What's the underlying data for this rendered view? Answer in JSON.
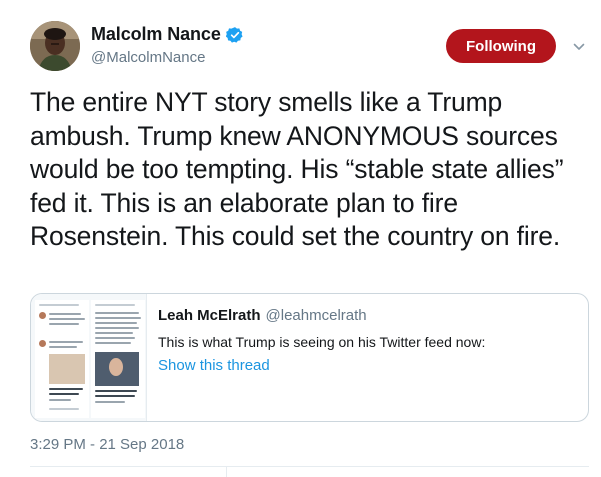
{
  "tweet": {
    "display_name": "Malcolm Nance",
    "handle": "@MalcolmNance",
    "follow_label": "Following",
    "text": "The entire NYT story smells like a Trump ambush. Trump knew ANONYMOUS sources would be too tempting. His “stable state allies” fed it. This is an elaborate plan to fire Rosenstein. This could set the country on fire.",
    "timestamp": "3:29 PM - 21 Sep 2018"
  },
  "quote": {
    "author_name": "Leah McElrath",
    "author_handle": "@leahmcelrath",
    "body": "This is what Trump is seeing on his Twitter feed now:",
    "link_label": "Show this thread"
  },
  "icons": {
    "verified": "verified-badge-icon",
    "caret": "chevron-down-icon"
  },
  "colors": {
    "follow_button": "#b3151c",
    "link": "#1b95e0",
    "verified": "#1da1f2",
    "secondary_text": "#657786"
  }
}
